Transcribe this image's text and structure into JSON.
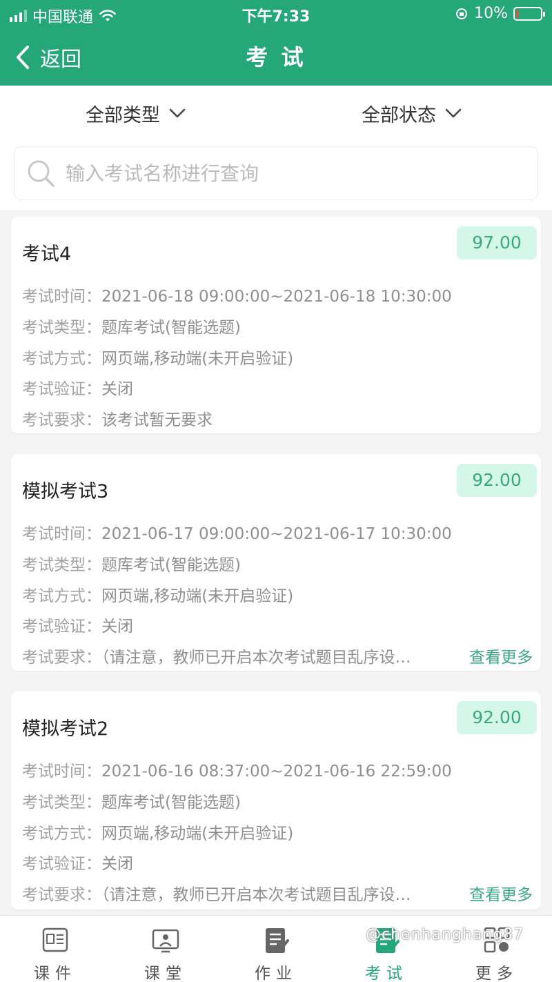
{
  "status_bar": {
    "carrier": "中国联通",
    "time": "下午7:33",
    "battery": "10%",
    "battery_level": 0.1
  },
  "nav": {
    "back_label": "返回",
    "title": "考 试"
  },
  "filters": {
    "type": "全部类型",
    "status": "全部状态"
  },
  "search": {
    "placeholder": "输入考试名称进行查询"
  },
  "labels": {
    "time": "考试时间：",
    "type": "考试类型：",
    "mode": "考试方式：",
    "verify": "考试验证：",
    "requirement": "考试要求："
  },
  "exams": [
    {
      "title": "考试4",
      "score": "97.00",
      "time": "2021-06-18 09:00:00~2021-06-18 10:30:00",
      "type": "题库考试(智能选题)",
      "mode": "网页端,移动端(未开启验证)",
      "verify": "关闭",
      "requirement": "该考试暂无要求",
      "more": ""
    },
    {
      "title": "模拟考试3",
      "score": "92.00",
      "time": "2021-06-17 09:00:00~2021-06-17 10:30:00",
      "type": "题库考试(智能选题)",
      "mode": "网页端,移动端(未开启验证)",
      "verify": "关闭",
      "requirement": "（请注意，教师已开启本次考试题目乱序设…",
      "more": "查看更多"
    },
    {
      "title": "模拟考试2",
      "score": "92.00",
      "time": "2021-06-16 08:37:00~2021-06-16 22:59:00",
      "type": "题库考试(智能选题)",
      "mode": "网页端,移动端(未开启验证)",
      "verify": "关闭",
      "requirement": "（请注意，教师已开启本次考试题目乱序设…",
      "more": "查看更多"
    }
  ],
  "tabbar": [
    {
      "label": "课件",
      "icon": "courseware-icon"
    },
    {
      "label": "课堂",
      "icon": "classroom-icon"
    },
    {
      "label": "作业",
      "icon": "homework-icon"
    },
    {
      "label": "考试",
      "icon": "exam-icon"
    },
    {
      "label": "更多",
      "icon": "more-grid-icon"
    }
  ],
  "active_tab": "考试",
  "watermark": "@chenhanghang87",
  "colors": {
    "brand": "#26a77a",
    "score_bg": "#d5f7ea",
    "score_text": "#3aa880",
    "link": "#3aa880"
  }
}
